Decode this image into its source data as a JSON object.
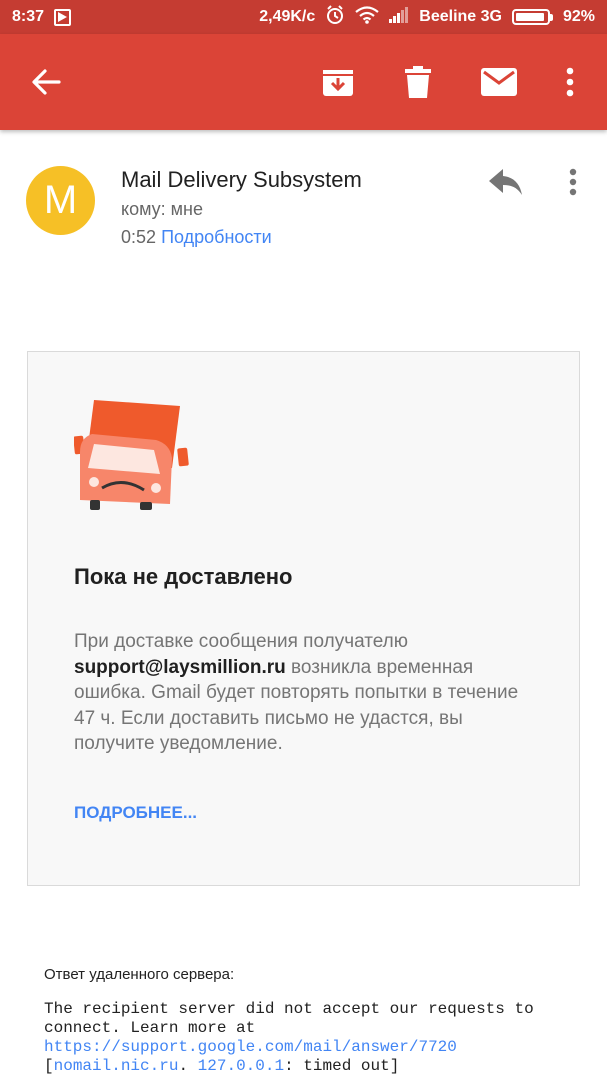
{
  "status_bar": {
    "time": "8:37",
    "network_speed": "2,49K/c",
    "carrier": "Beeline 3G",
    "battery": "92%",
    "battery_level": 0.92
  },
  "toolbar": {
    "back_icon": "arrow-back-icon",
    "archive_icon": "archive-icon",
    "delete_icon": "trash-icon",
    "mark_unread_icon": "mail-icon",
    "more_icon": "more-vert-icon",
    "color": "#db4437"
  },
  "message": {
    "avatar_letter": "M",
    "avatar_color": "#f6c026",
    "sender": "Mail Delivery Subsystem",
    "recipient": "кому: мне",
    "time": "0:52",
    "details_link": "Подробности"
  },
  "card": {
    "title": "Пока не доставлено",
    "body_prefix": "При доставке сообщения получателю",
    "recipient_email": "support@laysmillion.ru",
    "body_suffix": "возникла временная ошибка. Gmail будет повторять попытки в течение 47 ч. Если доставить письмо не удастся, вы получите уведомление.",
    "more_link": "ПОДРОБНЕЕ..."
  },
  "remote": {
    "label": "Ответ удаленного сервера:",
    "text_1": "The recipient server did not accept our requests to connect. Learn more at",
    "link": "https://support.google.com/mail/answer/7720",
    "text_2": "[",
    "host": "nomail.nic.ru",
    "text_3": ".",
    "ip": "127.0.0.1",
    "text_4": ": timed out]"
  }
}
